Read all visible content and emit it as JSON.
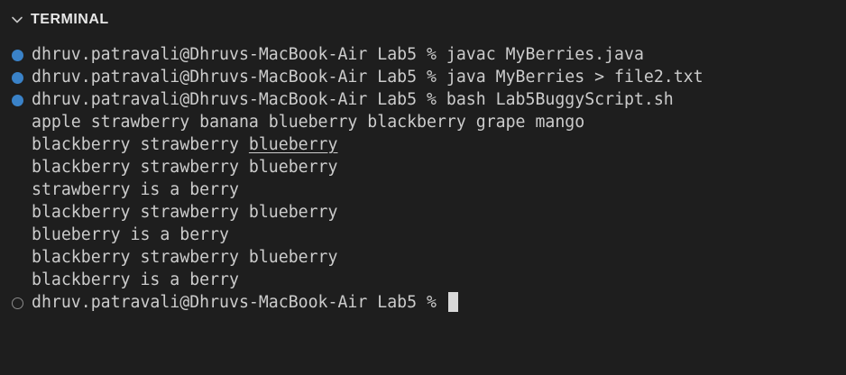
{
  "panel": {
    "title": "TERMINAL"
  },
  "icons": {
    "collapse": "chevron-down-icon",
    "success_decoration": "filled-circle-icon",
    "pending_decoration": "hollow-circle-icon"
  },
  "colors": {
    "background": "#1e1e1e",
    "text": "#cccccc",
    "decoration_success": "#3a82c8",
    "decoration_pending": "#8b8b8b",
    "cursor": "#d8d8d8"
  },
  "terminal": {
    "commands": [
      "dhruv.patravali@Dhruvs-MacBook-Air Lab5 % javac MyBerries.java",
      "dhruv.patravali@Dhruvs-MacBook-Air Lab5 % java MyBerries > file2.txt",
      "dhruv.patravali@Dhruvs-MacBook-Air Lab5 % bash Lab5BuggyScript.sh"
    ],
    "output": {
      "line1": "apple strawberry banana blueberry blackberry grape mango",
      "line2_prefix": "blackberry strawberry ",
      "line2_underlined": "blueberry",
      "line3": "blackberry strawberry blueberry",
      "line4": "strawberry is a berry",
      "line5": "blackberry strawberry blueberry",
      "line6": "blueberry is a berry",
      "line7": "blackberry strawberry blueberry",
      "line8": "blackberry is a berry"
    },
    "prompt": "dhruv.patravali@Dhruvs-MacBook-Air Lab5 % "
  }
}
